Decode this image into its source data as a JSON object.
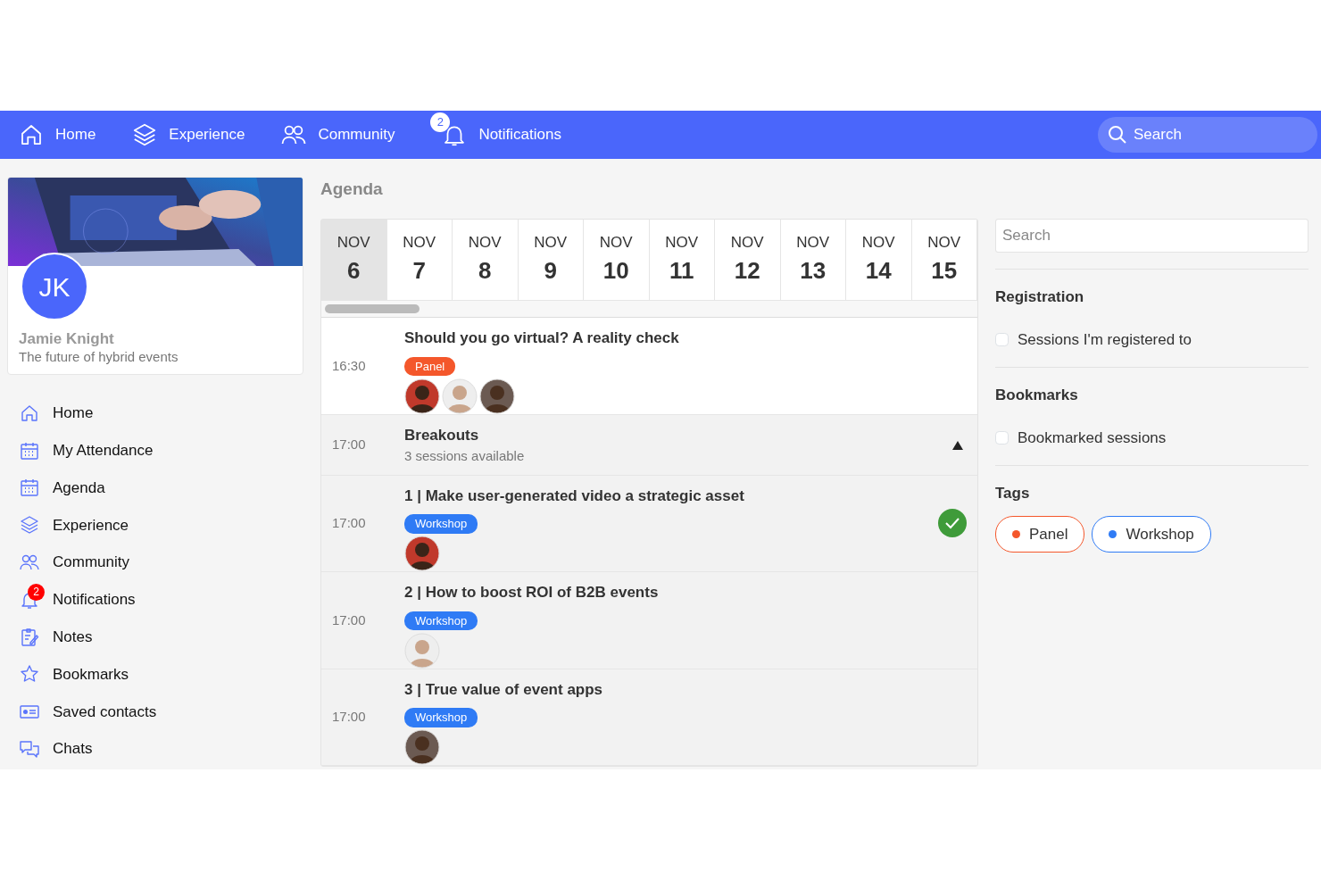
{
  "topnav": {
    "items": [
      {
        "label": "Home"
      },
      {
        "label": "Experience"
      },
      {
        "label": "Community"
      },
      {
        "label": "Notifications",
        "badge": "2"
      }
    ],
    "search": {
      "placeholder": "Search"
    }
  },
  "profile": {
    "initials": "JK",
    "name": "Jamie Knight",
    "tagline": "The future of hybrid events"
  },
  "sidebar": {
    "items": [
      {
        "label": "Home"
      },
      {
        "label": "My Attendance"
      },
      {
        "label": "Agenda"
      },
      {
        "label": "Experience"
      },
      {
        "label": "Community"
      },
      {
        "label": "Notifications",
        "badge": "2"
      },
      {
        "label": "Notes"
      },
      {
        "label": "Bookmarks"
      },
      {
        "label": "Saved contacts"
      },
      {
        "label": "Chats"
      }
    ]
  },
  "agenda": {
    "title": "Agenda",
    "dates": [
      {
        "month": "NOV",
        "day": "6",
        "selected": true
      },
      {
        "month": "NOV",
        "day": "7",
        "selected": false
      },
      {
        "month": "NOV",
        "day": "8",
        "selected": false
      },
      {
        "month": "NOV",
        "day": "9",
        "selected": false
      },
      {
        "month": "NOV",
        "day": "10",
        "selected": false
      },
      {
        "month": "NOV",
        "day": "11",
        "selected": false
      },
      {
        "month": "NOV",
        "day": "12",
        "selected": false
      },
      {
        "month": "NOV",
        "day": "13",
        "selected": false
      },
      {
        "month": "NOV",
        "day": "14",
        "selected": false
      },
      {
        "month": "NOV",
        "day": "15",
        "selected": false
      }
    ],
    "sessions": [
      {
        "kind": "session",
        "time": "16:30",
        "title": "Should you go virtual? A reality check",
        "tag": {
          "label": "Panel",
          "color": "#f4572b"
        },
        "registered": false
      },
      {
        "kind": "group",
        "time": "17:00",
        "title": "Breakouts",
        "subtitle": "3 sessions available",
        "expanded": true,
        "children": [
          {
            "kind": "session",
            "time": "17:00",
            "title": "1 | Make user-generated video a strategic asset",
            "tag": {
              "label": "Workshop",
              "color": "#2f7bf5"
            },
            "registered": true
          },
          {
            "kind": "session",
            "time": "17:00",
            "title": "2 | How to boost ROI of B2B events",
            "tag": {
              "label": "Workshop",
              "color": "#2f7bf5"
            },
            "registered": false
          },
          {
            "kind": "session",
            "time": "17:00",
            "title": "3 | True value of event apps",
            "tag": {
              "label": "Workshop",
              "color": "#2f7bf5"
            },
            "registered": false
          }
        ]
      }
    ]
  },
  "filters": {
    "search": {
      "placeholder": "Search"
    },
    "sections": [
      {
        "kind": "checkbox",
        "heading": "Registration",
        "label": "Sessions I'm registered to",
        "checked": false
      },
      {
        "kind": "checkbox",
        "heading": "Bookmarks",
        "label": "Bookmarked sessions",
        "checked": false
      },
      {
        "kind": "tags",
        "heading": "Tags",
        "tags": [
          {
            "label": "Panel",
            "color": "#f4572b"
          },
          {
            "label": "Workshop",
            "color": "#2f7bf5"
          }
        ]
      }
    ]
  }
}
